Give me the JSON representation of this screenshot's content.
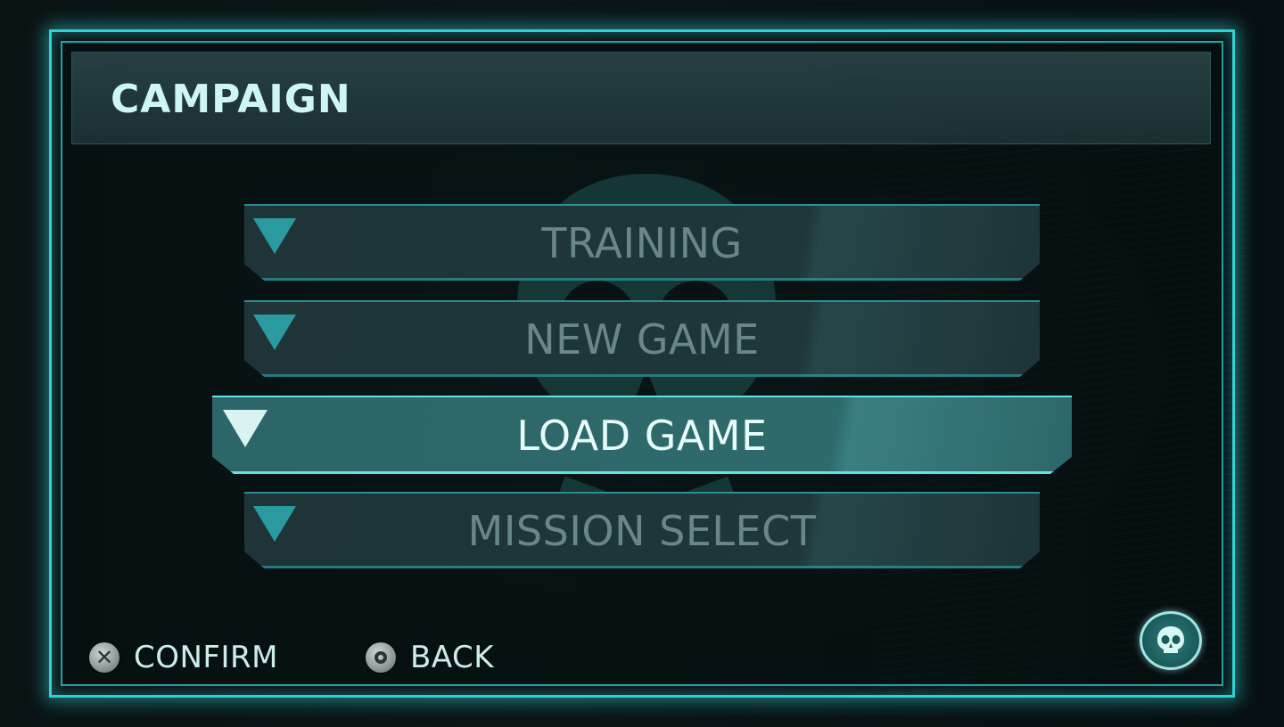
{
  "header": {
    "title": "CAMPAIGN"
  },
  "menu": {
    "items": [
      {
        "label": "TRAINING",
        "state": "normal"
      },
      {
        "label": "NEW GAME",
        "state": "normal"
      },
      {
        "label": "LOAD GAME",
        "state": "selected"
      },
      {
        "label": "MISSION SELECT",
        "state": "normal"
      }
    ]
  },
  "footer": {
    "confirm": {
      "label": "CONFIRM",
      "icon": "cross-button-icon"
    },
    "back": {
      "label": "BACK",
      "icon": "circle-button-icon"
    }
  },
  "emblem": {
    "icon": "skull-emblem-icon"
  },
  "colors": {
    "accent": "#2fd0d6",
    "selected_bg": "#2d6668",
    "normal_text": "#6a8788",
    "selected_text": "#e6fbfa",
    "title_text": "#cdf6f4"
  }
}
